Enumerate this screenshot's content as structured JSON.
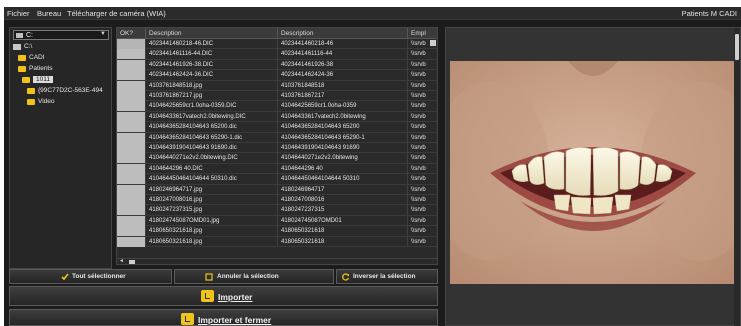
{
  "menubar": {
    "items": [
      "Fichier",
      "Bureau",
      "Télécharger de caméra (WIA)"
    ],
    "right_title": "Patients M CADI"
  },
  "tree": {
    "drive_value": "C:",
    "nodes": [
      {
        "label": "C:\\",
        "icon": "drive-icon"
      },
      {
        "label": "CADI",
        "icon": "folder-icon"
      },
      {
        "label": "Patients",
        "icon": "folder-icon"
      },
      {
        "label": "1011",
        "icon": "folder-icon",
        "selected": true
      },
      {
        "label": "{99C77D2C-563E-494",
        "icon": "folder-icon"
      },
      {
        "label": "Video",
        "icon": "folder-icon"
      }
    ]
  },
  "table": {
    "headers": [
      "OK?",
      "Description",
      "Description",
      "Empl"
    ],
    "rows": [
      [
        "",
        "4023441460218-46.DIC",
        "4023441460218-46",
        "\\\\srvb"
      ],
      [
        "",
        "4023441461116-44.DIC",
        "4023441461116-44",
        "\\\\srvb"
      ],
      [
        "",
        "4023441461926-38.DIC",
        "4023441461926-38",
        "\\\\srvb"
      ],
      [
        "",
        "4023441462424-36.DIC",
        "4023441462424-36",
        "\\\\srvb"
      ],
      [
        "",
        "4103761848518.jpg",
        "4103761848518",
        "\\\\srvb"
      ],
      [
        "",
        "4103761867217.jpg",
        "4103761867217",
        "\\\\srvb"
      ],
      [
        "",
        "41046425659cr1.0oha-0359.DIC",
        "41046425659cr1.0oha-0359",
        "\\\\srvb"
      ],
      [
        "",
        "41046433617vatech2.0bitewing.DIC",
        "41046433617vatech2.0bitewing",
        "\\\\srvb"
      ],
      [
        "",
        "410464365284104643 65200.dic",
        "410464365284104643 65200",
        "\\\\srvb"
      ],
      [
        "",
        "410464365284104643 65290-1.dic",
        "410464365284104643 65290-1",
        "\\\\srvb"
      ],
      [
        "",
        "410464391904104643 91690.dic",
        "410464391904104643 91690",
        "\\\\srvb"
      ],
      [
        "",
        "41046440271e2v2.0bitewing.DIC",
        "41046440271e2v2.0bitewing",
        "\\\\srvb"
      ],
      [
        "",
        "4104644296 40.DIC",
        "4104644296 40",
        "\\\\srvb"
      ],
      [
        "",
        "410464450464104644 50310.dic",
        "410464450464104644 50310",
        "\\\\srvb"
      ],
      [
        "",
        "4180246964717.jpg",
        "4180246964717",
        "\\\\srvb"
      ],
      [
        "",
        "4180247008016.jpg",
        "4180247008016",
        "\\\\srvb"
      ],
      [
        "",
        "4180247237315.jpg",
        "4180247237315",
        "\\\\srvb"
      ],
      [
        "",
        "418024745087OMD01.jpg",
        "418024745087OMD01",
        "\\\\srvb"
      ],
      [
        "",
        "4180650321618.jpg",
        "4180650321618",
        "\\\\srvb"
      ],
      [
        "",
        "4180650321618.jpg",
        "4180650321618",
        "\\\\srvb"
      ]
    ]
  },
  "buttons": {
    "select_all": "Tout sélectionner",
    "cancel_selection": "Annuler la sélection",
    "invert_selection": "Inverser la sélection",
    "import": "Importer",
    "import_close": "Importer et fermer"
  },
  "colors": {
    "background": "#1c1c1c",
    "folder": "#f2c21a",
    "accent_icon": "#f0c419"
  }
}
